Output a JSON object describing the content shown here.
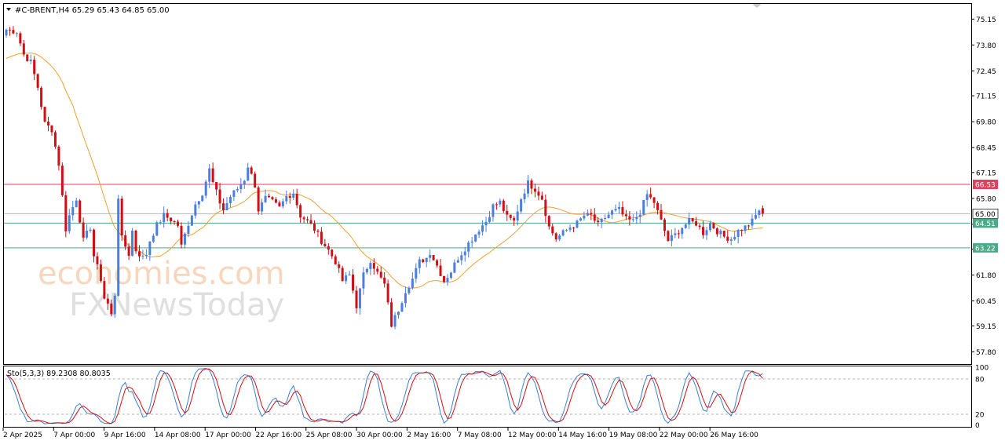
{
  "header": {
    "symbol_line": "#C-BRENT,H4  65.29 65.43 64.85 65.00"
  },
  "indicator": {
    "label": "Sto(5,3,3) 89.2308 80.8035",
    "levels": [
      100,
      80,
      20,
      0
    ],
    "level_labels": [
      "100",
      "80",
      "20",
      "0"
    ]
  },
  "watermark": {
    "line1": "economies.com",
    "line2": "FXNewsToday"
  },
  "chart_data": [
    {
      "type": "candlestick",
      "symbol": "#C-BRENT",
      "timeframe": "H4",
      "ohlc_current": {
        "open": 65.29,
        "high": 65.43,
        "low": 64.85,
        "close": 65.0
      },
      "ylim": [
        57.2,
        75.9
      ],
      "y_ticks": [
        "75.15",
        "73.80",
        "72.45",
        "71.15",
        "69.80",
        "68.45",
        "67.15",
        "65.80",
        "64.45",
        "63.15",
        "61.80",
        "60.45",
        "59.15",
        "57.80"
      ],
      "x_ticks": [
        "2 Apr 2025",
        "7 Apr 00:00",
        "9 Apr 16:00",
        "14 Apr 08:00",
        "17 Apr 00:00",
        "22 Apr 16:00",
        "25 Apr 08:00",
        "30 Apr 00:00",
        "2 May 16:00",
        "7 May 08:00",
        "12 May 00:00",
        "14 May 16:00",
        "19 May 08:00",
        "22 May 00:00",
        "26 May 16:00"
      ],
      "colors": {
        "up": "#4a7fe0",
        "down": "#d10e14",
        "ma": "#f0a030"
      },
      "horizontal_lines": [
        {
          "value": 66.53,
          "label": "66.53",
          "color": "#e0405c"
        },
        {
          "value": 65.0,
          "label": "65.00",
          "color": "#b8b8b8"
        },
        {
          "value": 64.51,
          "label": "64.51",
          "color": "#4daa88"
        },
        {
          "value": 63.22,
          "label": "63.22",
          "color": "#4daa88"
        }
      ],
      "close_path": [
        [
          0,
          74.6
        ],
        [
          3,
          74.5
        ],
        [
          5,
          73.3
        ],
        [
          7,
          72.9
        ],
        [
          9,
          71.6
        ],
        [
          11,
          69.7
        ],
        [
          13,
          69.4
        ],
        [
          15,
          67.6
        ],
        [
          17,
          64.2
        ],
        [
          18,
          64.9
        ],
        [
          20,
          65.8
        ],
        [
          22,
          63.6
        ],
        [
          24,
          64.3
        ],
        [
          25,
          62.8
        ],
        [
          27,
          61.6
        ],
        [
          28,
          60.6
        ],
        [
          29,
          60.3
        ],
        [
          30,
          59.7
        ],
        [
          31,
          60.8
        ],
        [
          32,
          65.9
        ],
        [
          33,
          63.7
        ],
        [
          35,
          62.9
        ],
        [
          36,
          64.1
        ],
        [
          37,
          63.1
        ],
        [
          39,
          62.7
        ],
        [
          40,
          62.9
        ],
        [
          41,
          63.6
        ],
        [
          43,
          64.4
        ],
        [
          45,
          64.9
        ],
        [
          47,
          64.7
        ],
        [
          49,
          64.4
        ],
        [
          50,
          63.3
        ],
        [
          52,
          64.5
        ],
        [
          54,
          65.5
        ],
        [
          56,
          66.1
        ],
        [
          58,
          67.3
        ],
        [
          59,
          66.6
        ],
        [
          61,
          65.6
        ],
        [
          62,
          65.2
        ],
        [
          64,
          65.9
        ],
        [
          66,
          66.3
        ],
        [
          68,
          66.8
        ],
        [
          69,
          67.5
        ],
        [
          71,
          66.5
        ],
        [
          72,
          65.2
        ],
        [
          74,
          65.8
        ],
        [
          76,
          65.6
        ],
        [
          78,
          65.3
        ],
        [
          80,
          65.9
        ],
        [
          82,
          66.1
        ],
        [
          84,
          64.9
        ],
        [
          86,
          64.6
        ],
        [
          88,
          64.2
        ],
        [
          90,
          63.6
        ],
        [
          92,
          63.1
        ],
        [
          94,
          62.5
        ],
        [
          96,
          61.5
        ],
        [
          98,
          61.8
        ],
        [
          100,
          60.2
        ],
        [
          102,
          61.8
        ],
        [
          104,
          62.6
        ],
        [
          106,
          61.9
        ],
        [
          108,
          61.3
        ],
        [
          110,
          59.2
        ],
        [
          112,
          60.0
        ],
        [
          114,
          61.0
        ],
        [
          116,
          61.6
        ],
        [
          118,
          62.5
        ],
        [
          120,
          62.7
        ],
        [
          121,
          63.0
        ],
        [
          123,
          62.3
        ],
        [
          125,
          61.5
        ],
        [
          127,
          62.0
        ],
        [
          129,
          62.7
        ],
        [
          131,
          63.2
        ],
        [
          133,
          63.7
        ],
        [
          135,
          64.2
        ],
        [
          137,
          64.6
        ],
        [
          139,
          65.4
        ],
        [
          141,
          65.6
        ],
        [
          143,
          64.8
        ],
        [
          145,
          64.6
        ],
        [
          147,
          65.8
        ],
        [
          149,
          66.6
        ],
        [
          151,
          66.3
        ],
        [
          153,
          65.8
        ],
        [
          155,
          64.3
        ],
        [
          157,
          63.7
        ],
        [
          159,
          64.0
        ],
        [
          161,
          64.3
        ],
        [
          163,
          64.5
        ],
        [
          165,
          64.9
        ],
        [
          167,
          64.9
        ],
        [
          169,
          64.4
        ],
        [
          171,
          64.8
        ],
        [
          173,
          65.1
        ],
        [
          175,
          65.2
        ],
        [
          177,
          64.7
        ],
        [
          179,
          64.6
        ],
        [
          181,
          65.1
        ],
        [
          183,
          66.0
        ],
        [
          185,
          65.6
        ],
        [
          187,
          64.6
        ],
        [
          189,
          63.6
        ],
        [
          191,
          63.9
        ],
        [
          193,
          64.3
        ],
        [
          195,
          64.6
        ],
        [
          197,
          64.5
        ],
        [
          199,
          64.0
        ],
        [
          201,
          64.5
        ],
        [
          203,
          64.1
        ],
        [
          205,
          63.8
        ],
        [
          207,
          63.7
        ],
        [
          209,
          64.1
        ],
        [
          211,
          64.3
        ],
        [
          213,
          64.6
        ],
        [
          215,
          65.2
        ],
        [
          216,
          65.0
        ]
      ]
    },
    {
      "type": "line",
      "name": "Sto(5,3,3)",
      "ylim": [
        0,
        100
      ],
      "levels": [
        80,
        20
      ],
      "series": [
        {
          "name": "main",
          "color": "#3a7fd5"
        },
        {
          "name": "signal",
          "color": "#d10e14"
        }
      ],
      "current": {
        "main": 89.2308,
        "signal": 80.8035
      }
    }
  ]
}
